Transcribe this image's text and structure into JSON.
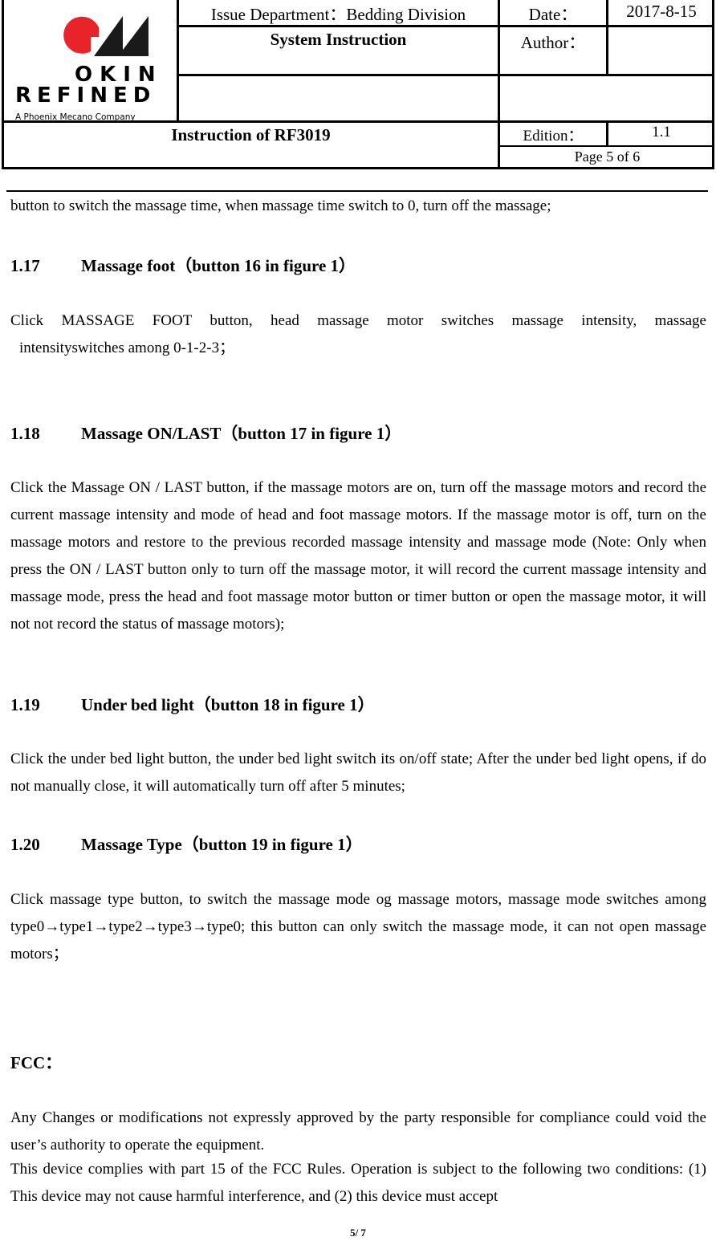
{
  "header": {
    "logo": {
      "brand_line1": "OKIN",
      "brand_line2": "REFINED",
      "tagline": "A Phoenix Mecano Company",
      "colors": {
        "red": "#e8232a",
        "black": "#1a1a1a"
      }
    },
    "issue_department": "Issue Department：Bedding Division",
    "date_label": "Date：",
    "date_value": "2017-8-15",
    "system_instruction": "System Instruction",
    "author_label": "Author：",
    "author_value": "",
    "document_title": "Instruction of RF3019",
    "edition_label": "Edition：",
    "edition_value": "1.1",
    "page_info": "Page 5 of 6"
  },
  "body": {
    "continuation": "button to switch the massage time, when massage time switch to 0, turn off the massage;",
    "sections": [
      {
        "number": "1.17",
        "title": "Massage foot（button 16 in figure 1）",
        "paragraphs": [
          "Click MASSAGE FOOT button, head massage motor switches massage intensity, massage",
          "intensityswitches among 0-1-2-3；"
        ]
      },
      {
        "number": "1.18",
        "title": "Massage ON/LAST（button 17 in figure 1）",
        "paragraphs": [
          "Click the Massage ON / LAST button, if the massage motors are on, turn off the massage motors and record the current massage intensity and mode of head and foot massage motors. If the massage motor is off, turn on the massage motors and restore to the previous recorded massage intensity and massage mode (Note: Only when press the ON / LAST button only to turn off the massage motor, it will record the current massage intensity and massage mode, press the head and foot massage motor button or timer button or open the massage motor, it will not not record the status of massage motors);"
        ]
      },
      {
        "number": "1.19",
        "title": "Under bed light（button 18 in figure 1）",
        "paragraphs": [
          "Click the under bed light button, the under bed light switch its on/off state; After the under bed light opens, if do not manually close, it will automatically turn off after 5 minutes;"
        ]
      },
      {
        "number": "1.20",
        "title": "Massage Type（button 19 in figure 1）",
        "paragraphs": [
          "Click massage type button, to switch the massage mode og massage motors,  massage mode switches among type0→type1→type2→type3→type0; this button can only switch the massage mode, it can not open massage motors；"
        ]
      }
    ],
    "fcc": {
      "heading": "FCC：",
      "paragraph1": "Any Changes or modifications not expressly approved by the party responsible for compliance could void the user’s authority to operate the equipment.",
      "paragraph2": "This device complies with part 15 of the FCC Rules. Operation is subject to the following two conditions: (1) This device may not cause harmful interference, and (2) this device must accept"
    }
  },
  "footer": {
    "page_number": "5/ 7"
  }
}
